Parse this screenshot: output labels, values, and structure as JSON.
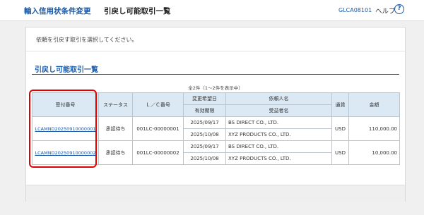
{
  "header": {
    "breadcrumb_parent": "輸入信用状条件変更",
    "page_title": "引戻し可能取引一覧",
    "screen_id": "GLCA08101",
    "help_label": "ヘルプ",
    "help_icon": "?"
  },
  "main": {
    "instruction": "依頼を引戻す取引を選択してください。",
    "section_title": "引戻し可能取引一覧",
    "count_text": "全2件（1～2件を表示中）"
  },
  "table": {
    "headers": {
      "receipt_no": "受付番号",
      "status": "ステータス",
      "lc_no": "Ｌ／Ｃ番号",
      "desired_change_date": "変更希望日",
      "expiry_date": "有効期限",
      "applicant": "依頼人名",
      "beneficiary": "受益者名",
      "currency": "通貨",
      "amount": "金額"
    },
    "rows": [
      {
        "receipt_no": "LCAMND20250910000001",
        "status": "承認待ち",
        "lc_no": "001LC-00000001",
        "desired_change_date": "2025/09/17",
        "expiry_date": "2025/10/08",
        "applicant": "BS DIRECT CO., LTD.",
        "beneficiary": "XYZ PRODUCTS CO., LTD.",
        "currency": "USD",
        "amount": "110,000.00"
      },
      {
        "receipt_no": "LCAMND20250910000002",
        "status": "承認待ち",
        "lc_no": "001LC-00000002",
        "desired_change_date": "2025/09/17",
        "expiry_date": "2025/10/08",
        "applicant": "BS DIRECT CO., LTD.",
        "beneficiary": "XYZ PRODUCTS CO., LTD.",
        "currency": "USD",
        "amount": "10,000.00"
      }
    ]
  },
  "colors": {
    "accent": "#1a5aa8",
    "header_cell": "#dbe9f4",
    "highlight_annotation": "#e00000"
  }
}
